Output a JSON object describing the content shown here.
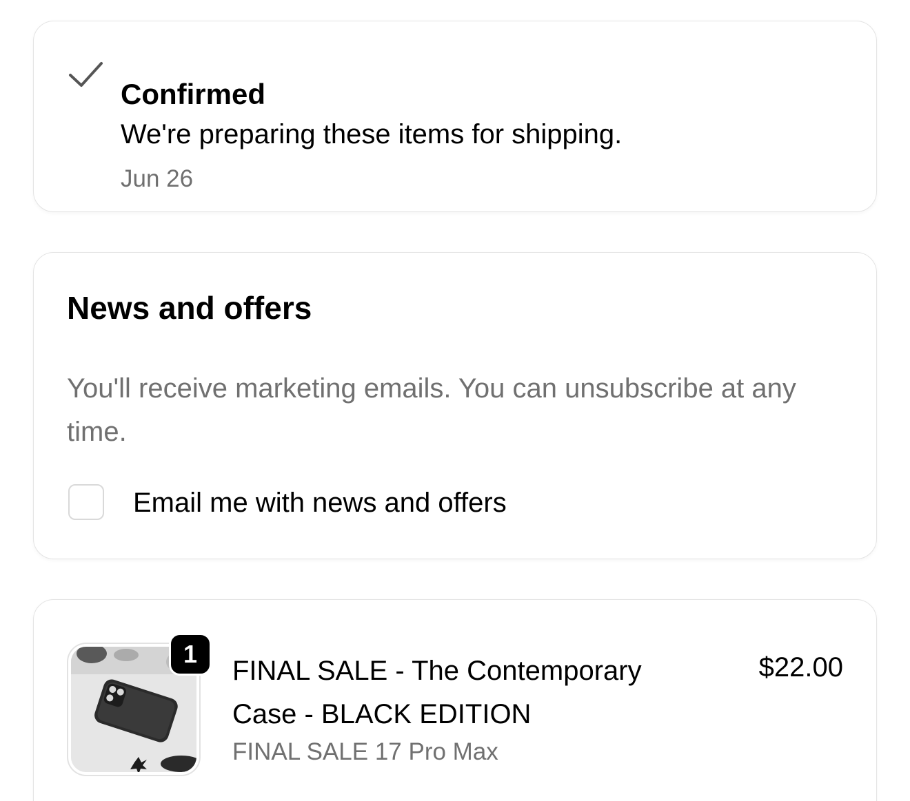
{
  "status": {
    "icon": "checkmark-icon",
    "title": "Confirmed",
    "description": "We're preparing these items for shipping.",
    "date": "Jun 26"
  },
  "news": {
    "title": "News and offers",
    "description": "You'll receive marketing emails. You can unsubscribe at any time.",
    "checkbox_label": "Email me with news and offers",
    "checkbox_checked": false
  },
  "order_item": {
    "quantity": "1",
    "name": "FINAL SALE - The Contemporary Case - BLACK EDITION",
    "variant": "FINAL SALE 17 Pro Max",
    "price": "$22.00",
    "image": "product-thumbnail"
  },
  "colors": {
    "text_primary": "#000000",
    "text_secondary": "#707070",
    "card_border": "#e4e4e4",
    "badge_bg": "#000000"
  }
}
